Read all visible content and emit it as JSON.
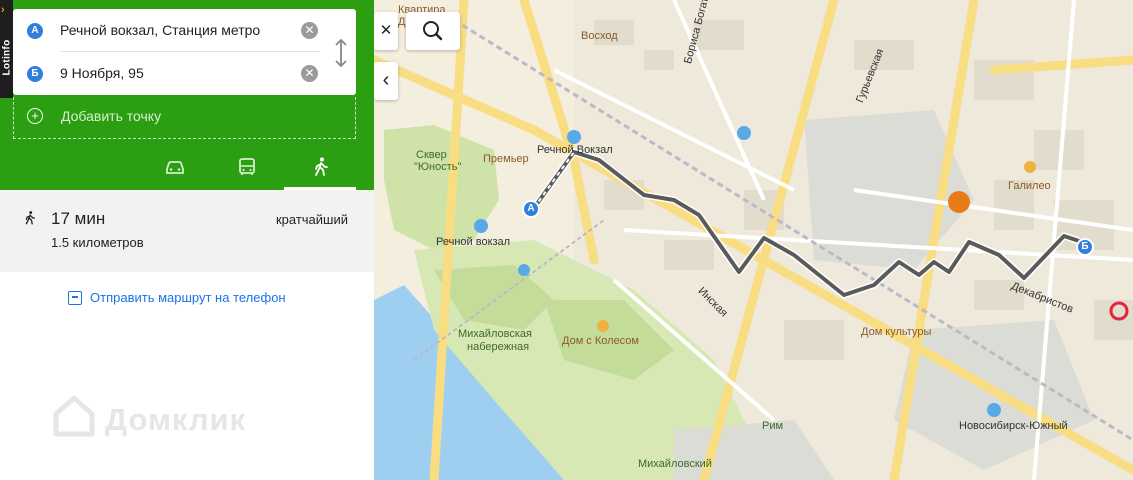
{
  "sidebar": {
    "brand": "Lotinfo",
    "from_marker": "А",
    "from_value": "Речной вокзал, Станция метро",
    "to_marker": "Б",
    "to_value": "9 Ноября, 95",
    "add_point_label": "Добавить точку",
    "modes": [
      "car-icon",
      "bus-icon",
      "walk-icon"
    ],
    "active_mode": "walk",
    "result": {
      "time": "17 мин",
      "distance": "1.5 километров",
      "tag": "кратчайший"
    },
    "send_label": "Отправить маршрут на телефон",
    "watermark": "Домклик"
  },
  "map": {
    "labels": {
      "kvartira": "Квартира",
      "dek": "Дек",
      "voshod": "Восход",
      "bogatkova": "Бориса Богаткова",
      "guryevskaya": "Гурьевская",
      "skver": "Сквер",
      "yunost": "\"Юность\"",
      "premier": "Премьер",
      "rechnoy_top": "Речной Вокзал",
      "rechnoy_bottom": "Речной вокзал",
      "galileo": "Галилео",
      "inskaya": "Инская",
      "dekabristov": "Декабристов",
      "mikh_nab_1": "Михайловская",
      "mikh_nab_2": "набережная",
      "dom_s_kolesom": "Дом с Колесом",
      "dom_kultury": "Дом культуры",
      "rim": "Рим",
      "novosib_yuzhny": "Новосибирск-Южный",
      "mikhaylovsky": "Михайловский"
    },
    "route_start": "А",
    "route_end": "Б",
    "controls": {
      "close": "✕",
      "collapse": "‹"
    },
    "colors": {
      "route": "#5a5a5a",
      "water": "#9fcff0",
      "park": "#cfe3a8",
      "road": "#f8dd83",
      "marker": "#2f7fdb"
    }
  }
}
